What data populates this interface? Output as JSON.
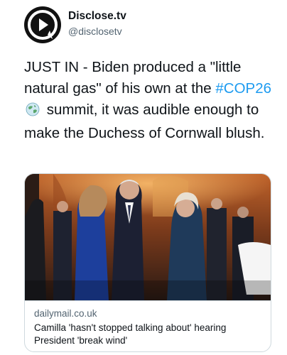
{
  "author": {
    "name": "Disclose.tv",
    "handle": "@disclosetv",
    "avatar_icon": "play-logo-icon"
  },
  "tweet": {
    "text_before": "JUST IN - Biden produced a \"little natural gas\" of his own at the ",
    "hashtag": "#COP26",
    "hashtag_emoji": "globe-emoji-icon",
    "text_after": " summit, it was audible enough to make the Duchess of Cornwall blush."
  },
  "link_card": {
    "image": "photo-of-event",
    "domain": "dailymail.co.uk",
    "headline": "Camilla 'hasn't stopped talking about' hearing President 'break wind'"
  },
  "colors": {
    "link": "#1d9bf0",
    "text": "#0f1419",
    "muted": "#536471",
    "border": "#cfd9de"
  }
}
